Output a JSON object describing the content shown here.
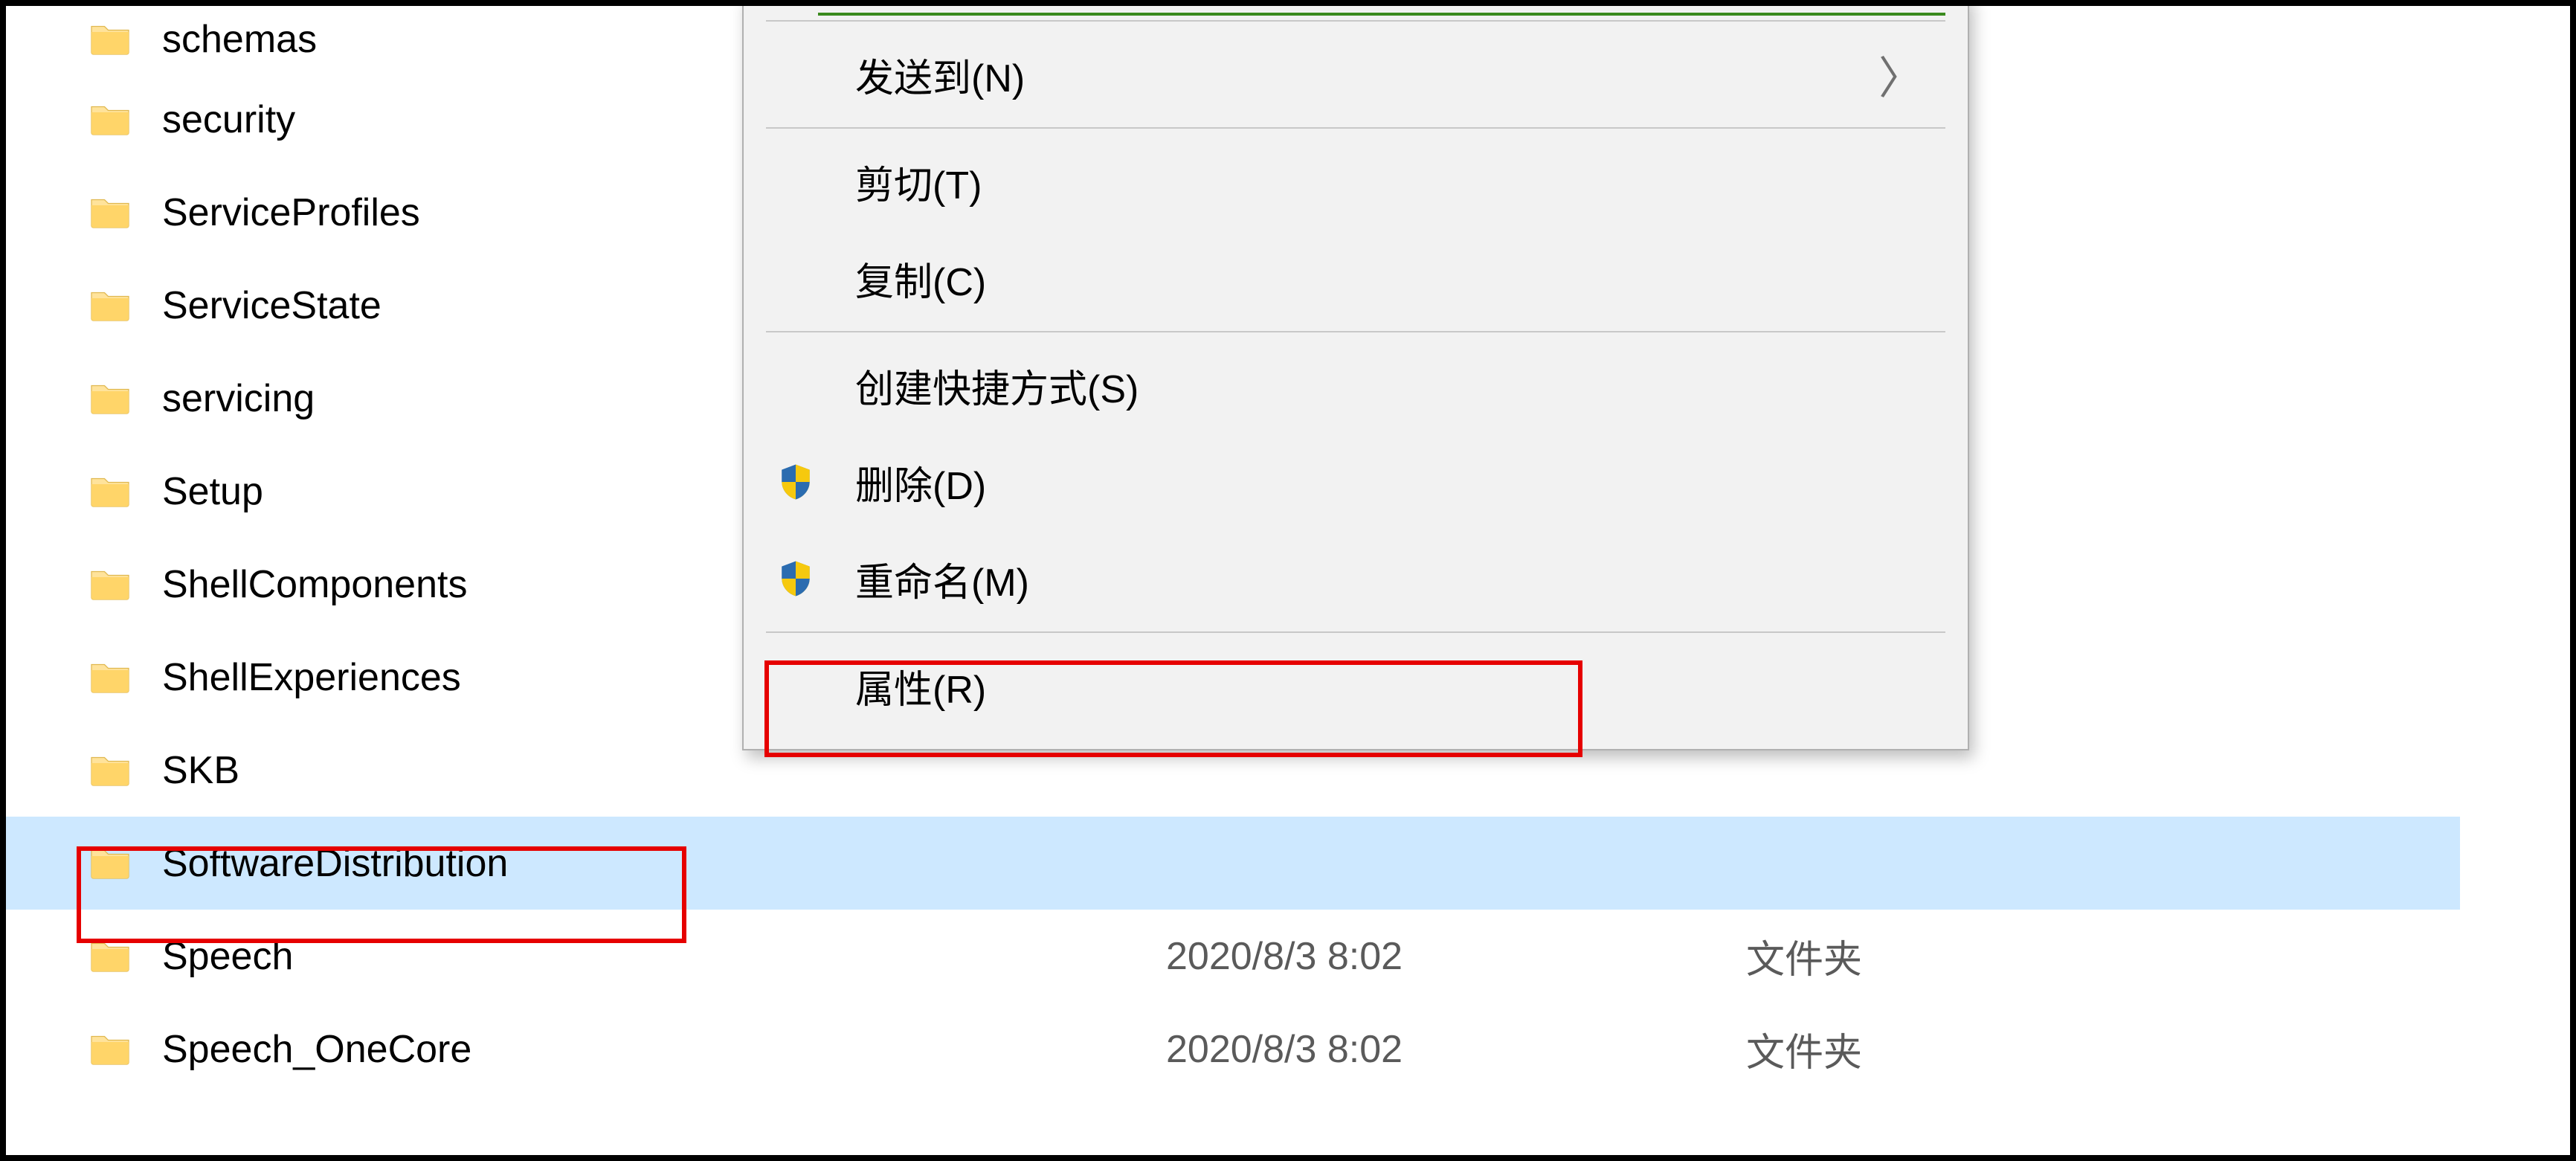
{
  "folders": [
    {
      "name": "schemas"
    },
    {
      "name": "security"
    },
    {
      "name": "ServiceProfiles"
    },
    {
      "name": "ServiceState"
    },
    {
      "name": "servicing"
    },
    {
      "name": "Setup"
    },
    {
      "name": "ShellComponents"
    },
    {
      "name": "ShellExperiences"
    },
    {
      "name": "SKB"
    },
    {
      "name": "SoftwareDistribution",
      "selected": true
    },
    {
      "name": "Speech",
      "date": "2020/8/3 8:02",
      "type": "文件夹"
    },
    {
      "name": "Speech_OneCore",
      "date": "2020/8/3 8:02",
      "type": "文件夹"
    }
  ],
  "context_menu": {
    "send_to": "发送到(N)",
    "cut": "剪切(T)",
    "copy": "复制(C)",
    "shortcut": "创建快捷方式(S)",
    "delete": "删除(D)",
    "rename": "重命名(M)",
    "properties": "属性(R)"
  }
}
